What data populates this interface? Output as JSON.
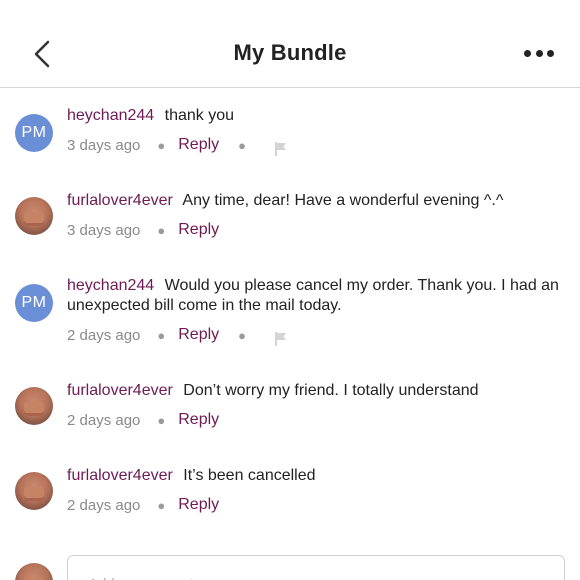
{
  "header": {
    "title": "My Bundle"
  },
  "comments": [
    {
      "avatar_initials": "PM",
      "username": "heychan244",
      "text": "thank you",
      "time": "3 days ago",
      "reply_label": "Reply",
      "has_flag": true
    },
    {
      "avatar_initials": "",
      "username": "furlalover4ever",
      "text": "Any time, dear! Have a wonderful evening ^.^",
      "time": "3 days ago",
      "reply_label": "Reply",
      "has_flag": false
    },
    {
      "avatar_initials": "PM",
      "username": "heychan244",
      "text": "Would you please cancel my order. Thank you. I had an unexpected bill come in the mail today.",
      "time": "2 days ago",
      "reply_label": "Reply",
      "has_flag": true
    },
    {
      "avatar_initials": "",
      "username": "furlalover4ever",
      "text": "Don’t worry my friend. I totally understand",
      "time": "2 days ago",
      "reply_label": "Reply",
      "has_flag": false
    },
    {
      "avatar_initials": "",
      "username": "furlalover4ever",
      "text": "It’s been cancelled",
      "time": "2 days ago",
      "reply_label": "Reply",
      "has_flag": false
    }
  ],
  "composer": {
    "placeholder": "Add a comment..."
  },
  "colors": {
    "username": "#6e1a55",
    "avatar_initials_bg": "#6b8fd6",
    "meta_gray": "#8a8a8a"
  },
  "icons": {
    "back": "chevron-left-icon",
    "more": "more-horizontal-icon",
    "flag": "flag-icon"
  }
}
